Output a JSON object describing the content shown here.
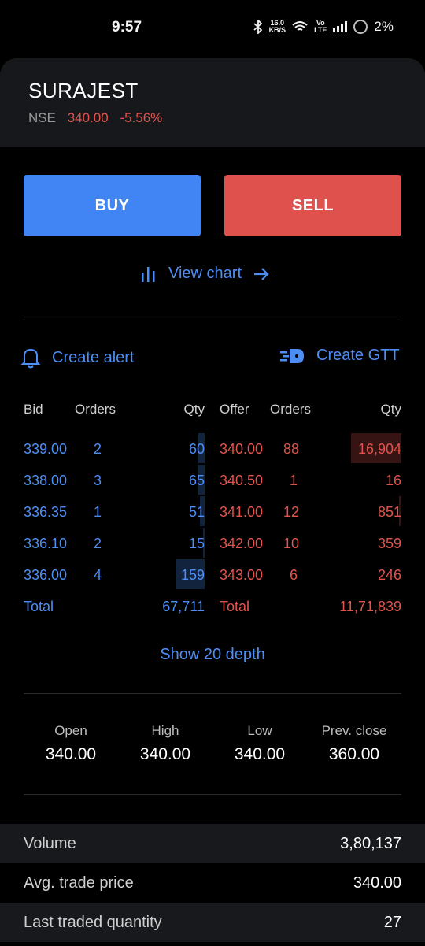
{
  "status_bar": {
    "time": "9:57",
    "net_speed_top": "16.0",
    "net_speed_bottom": "KB/S",
    "volte_top": "Vo",
    "volte_bottom": "LTE",
    "battery": "2%"
  },
  "instrument": {
    "symbol": "SURAJEST",
    "exchange": "NSE",
    "ltp": "340.00",
    "change": "-5.56%"
  },
  "actions": {
    "buy": "BUY",
    "sell": "SELL",
    "view_chart": "View chart",
    "create_alert": "Create alert",
    "create_gtt": "Create GTT"
  },
  "depth": {
    "headers": {
      "bid": "Bid",
      "bid_orders": "Orders",
      "bid_qty": "Qty",
      "offer": "Offer",
      "offer_orders": "Orders",
      "offer_qty": "Qty"
    },
    "rows": [
      {
        "bid": "339.00",
        "bid_orders": "2",
        "bid_qty": "60",
        "offer": "340.00",
        "offer_orders": "88",
        "offer_qty": "16,904"
      },
      {
        "bid": "338.00",
        "bid_orders": "3",
        "bid_qty": "65",
        "offer": "340.50",
        "offer_orders": "1",
        "offer_qty": "16"
      },
      {
        "bid": "336.35",
        "bid_orders": "1",
        "bid_qty": "51",
        "offer": "341.00",
        "offer_orders": "12",
        "offer_qty": "851"
      },
      {
        "bid": "336.10",
        "bid_orders": "2",
        "bid_qty": "15",
        "offer": "342.00",
        "offer_orders": "10",
        "offer_qty": "359"
      },
      {
        "bid": "336.00",
        "bid_orders": "4",
        "bid_qty": "159",
        "offer": "343.00",
        "offer_orders": "6",
        "offer_qty": "246"
      }
    ],
    "total_label_bid": "Total",
    "total_bid": "67,711",
    "total_label_offer": "Total",
    "total_offer": "11,71,839",
    "show_more": "Show 20 depth"
  },
  "ohlc": {
    "open_label": "Open",
    "open": "340.00",
    "high_label": "High",
    "high": "340.00",
    "low_label": "Low",
    "low": "340.00",
    "prev_label": "Prev. close",
    "prev": "360.00"
  },
  "stats": [
    {
      "label": "Volume",
      "value": "3,80,137"
    },
    {
      "label": "Avg. trade price",
      "value": "340.00"
    },
    {
      "label": "Last traded quantity",
      "value": "27"
    }
  ],
  "colors": {
    "accent": "#4d8ef5",
    "buy": "#4184f3",
    "sell": "#df514c",
    "negative": "#e0544d"
  }
}
